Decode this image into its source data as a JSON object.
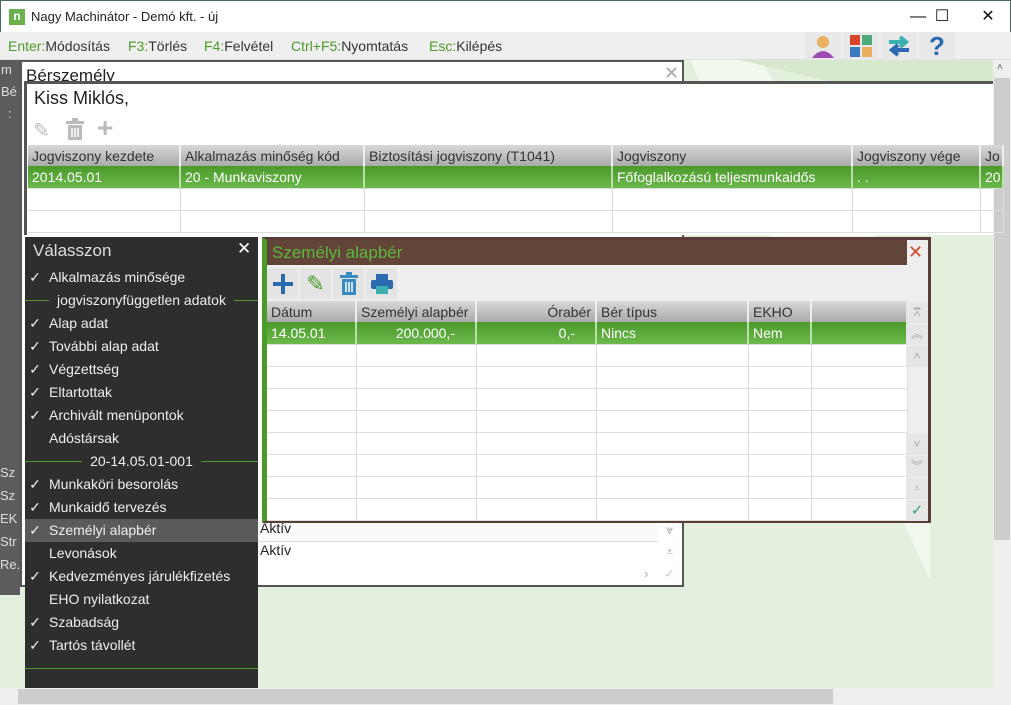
{
  "window": {
    "title": "Nagy Machinátor - Demó kft. - új",
    "app_icon": "n",
    "minimize": "—",
    "maximize": "☐",
    "close": "✕"
  },
  "toolbar": [
    {
      "key": "Enter:",
      "label": "Módosítás"
    },
    {
      "key": "F3:",
      "label": "Törlés"
    },
    {
      "key": "F4:",
      "label": "Felvétel"
    },
    {
      "key": "Ctrl+F5:",
      "label": "Nyomtatás"
    },
    {
      "key": "Esc:",
      "label": "Kilépés"
    }
  ],
  "left_strip": [
    "m",
    "Bé",
    ":",
    "",
    "",
    "",
    "",
    "",
    "",
    "",
    "Sz",
    "Sz",
    "EK",
    "Str",
    "Re.."
  ],
  "bersz": {
    "title": "Bérszemély",
    "name": "Kiss Miklós,",
    "columns": [
      "Jogviszony kezdete",
      "Alkalmazás minőség kód",
      "Biztosítási jogviszony (T1041)",
      "Jogviszony",
      "Jogviszony vége",
      "Jo"
    ],
    "rows": [
      [
        "2014.05.01",
        "20 - Munkaviszony",
        "",
        "Főfoglalkozású teljesmunkaidős",
        ". .",
        "20"
      ]
    ],
    "status_rows": [
      "Aktív",
      "Aktív"
    ]
  },
  "menu": {
    "title": "Válasszon",
    "close": "✕",
    "items": [
      {
        "type": "item",
        "checked": true,
        "label": "Alkalmazás minősége"
      },
      {
        "type": "sep",
        "label": "jogviszonyfüggetlen adatok"
      },
      {
        "type": "item",
        "checked": true,
        "label": "Alap adat"
      },
      {
        "type": "item",
        "checked": true,
        "label": "További alap adat"
      },
      {
        "type": "item",
        "checked": true,
        "label": "Végzettség"
      },
      {
        "type": "item",
        "checked": true,
        "label": "Eltartottak"
      },
      {
        "type": "item",
        "checked": true,
        "label": "Archivált menüpontok"
      },
      {
        "type": "item",
        "checked": false,
        "label": "Adóstársak"
      },
      {
        "type": "sep",
        "label": "20-14.05.01-001"
      },
      {
        "type": "item",
        "checked": true,
        "label": "Munkaköri besorolás"
      },
      {
        "type": "item",
        "checked": true,
        "label": "Munkaidő tervezés"
      },
      {
        "type": "item",
        "checked": true,
        "label": "Személyi alapbér",
        "active": true
      },
      {
        "type": "item",
        "checked": false,
        "label": "Levonások"
      },
      {
        "type": "item",
        "checked": true,
        "label": "Kedvezményes járulékfizetés"
      },
      {
        "type": "item",
        "checked": false,
        "label": "EHO nyilatkozat"
      },
      {
        "type": "item",
        "checked": true,
        "label": "Szabadság"
      },
      {
        "type": "item",
        "checked": true,
        "label": "Tartós távollét"
      }
    ]
  },
  "dialog": {
    "title": "Személyi alapbér",
    "close": "✕",
    "columns": [
      "Dátum",
      "Személyi alapbér",
      "Órabér",
      "Bér típus",
      "EKHO",
      ""
    ],
    "rows": [
      [
        "14.05.01",
        "200.000,-",
        "0,-",
        "Nincs",
        "Nem",
        ""
      ]
    ]
  },
  "colors": {
    "accent": "#4c9a2a",
    "dialog_title": "#634439",
    "menu_bg": "#2e2e2e"
  }
}
